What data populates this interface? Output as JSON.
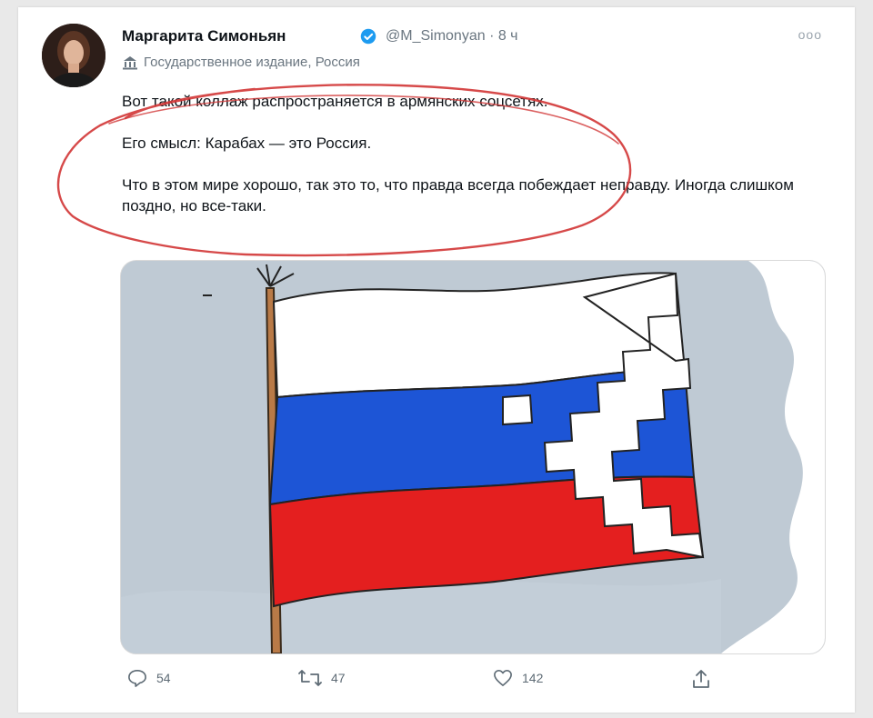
{
  "tweet": {
    "author_name": "Маргарита Симоньян",
    "handle_time": "@M_Simonyan · 8 ч",
    "label": "Государственное издание, Россия",
    "text_lines": [
      "Вот такой коллаж распространяется в армянских соцсетях.",
      "Его смысл: Карабах — это Россия.",
      "Что в этом мире хорошо, так это то, что правда всегда побеждает неправду. Иногда слишком поздно, но все-таки."
    ]
  },
  "actions": {
    "replies": "54",
    "retweets": "47",
    "likes": "142"
  },
  "icons": {
    "more": "more-icon",
    "verified": "verified-badge-icon",
    "label": "government-building-icon",
    "reply": "reply-icon",
    "retweet": "retweet-icon",
    "like": "like-icon",
    "share": "share-icon"
  },
  "colors": {
    "verified": "#1d9bf0",
    "annotation": "#d23a3a",
    "flag_white": "#ffffff",
    "flag_blue": "#1d55d6",
    "flag_red": "#e41f1f"
  }
}
